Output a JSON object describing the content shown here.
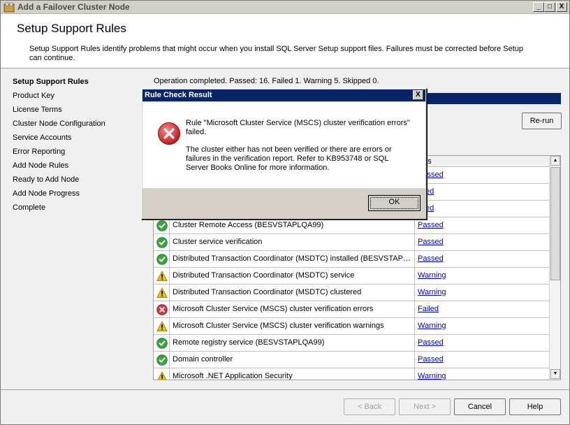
{
  "window": {
    "title": "Add a Failover Cluster Node",
    "minimize": "_",
    "maximize": "□",
    "close": "X"
  },
  "header": {
    "title": "Setup Support Rules",
    "description": "Setup Support Rules identify problems that might occur when you install SQL Server Setup support files. Failures must be corrected before Setup can continue."
  },
  "nav": {
    "items": [
      {
        "label": "Setup Support Rules",
        "active": true
      },
      {
        "label": "Product Key"
      },
      {
        "label": "License Terms"
      },
      {
        "label": "Cluster Node Configuration"
      },
      {
        "label": "Service Accounts"
      },
      {
        "label": "Error Reporting"
      },
      {
        "label": "Add Node Rules"
      },
      {
        "label": "Ready to Add Node"
      },
      {
        "label": "Add Node Progress"
      },
      {
        "label": "Complete"
      }
    ]
  },
  "content": {
    "operation_status": "Operation completed. Passed: 16.   Failed 1.   Warning 5.   Skipped 0.",
    "rerun_label": "Re-run",
    "status_header": "atus",
    "rows": [
      {
        "name": "",
        "status": "Passed",
        "icon": "passed"
      },
      {
        "name": "",
        "status": "ssed",
        "icon": "passed"
      },
      {
        "name": "",
        "status": "ssed",
        "icon": "passed"
      },
      {
        "name": "Cluster Remote Access (BESVSTAPLQA99)",
        "status": "Passed",
        "icon": "passed"
      },
      {
        "name": "Cluster service verification",
        "status": "Passed",
        "icon": "passed"
      },
      {
        "name": "Distributed Transaction Coordinator (MSDTC) installed (BESVSTAPLQ...",
        "status": "Passed",
        "icon": "passed"
      },
      {
        "name": "Distributed Transaction Coordinator (MSDTC) service",
        "status": "Warning",
        "icon": "warning"
      },
      {
        "name": "Distributed Transaction Coordinator (MSDTC) clustered",
        "status": "Warning",
        "icon": "warning"
      },
      {
        "name": "Microsoft Cluster Service (MSCS) cluster verification errors",
        "status": "Failed",
        "icon": "failed"
      },
      {
        "name": "Microsoft Cluster Service (MSCS) cluster verification warnings",
        "status": "Warning",
        "icon": "warning"
      },
      {
        "name": "Remote registry service (BESVSTAPLQA99)",
        "status": "Passed",
        "icon": "passed"
      },
      {
        "name": "Domain controller",
        "status": "Passed",
        "icon": "passed"
      },
      {
        "name": "Microsoft .NET Application Security",
        "status": "Warning",
        "icon": "warning"
      }
    ]
  },
  "footer": {
    "back": "< Back",
    "next": "Next >",
    "cancel": "Cancel",
    "help": "Help"
  },
  "dialog": {
    "title": "Rule Check Result",
    "close": "X",
    "message1": "Rule \"Microsoft Cluster Service (MSCS) cluster verification errors\" failed.",
    "message2": "The cluster either has not been verified or there are errors or failures in the verification report. Refer to KB953748 or SQL Server Books Online for more information.",
    "ok": "OK"
  },
  "colors": {
    "passed": "#3aa63a",
    "warning": "#f2c200",
    "failed": "#d9363e",
    "titlebar_active": "#0a246a",
    "link": "#0000cc"
  }
}
